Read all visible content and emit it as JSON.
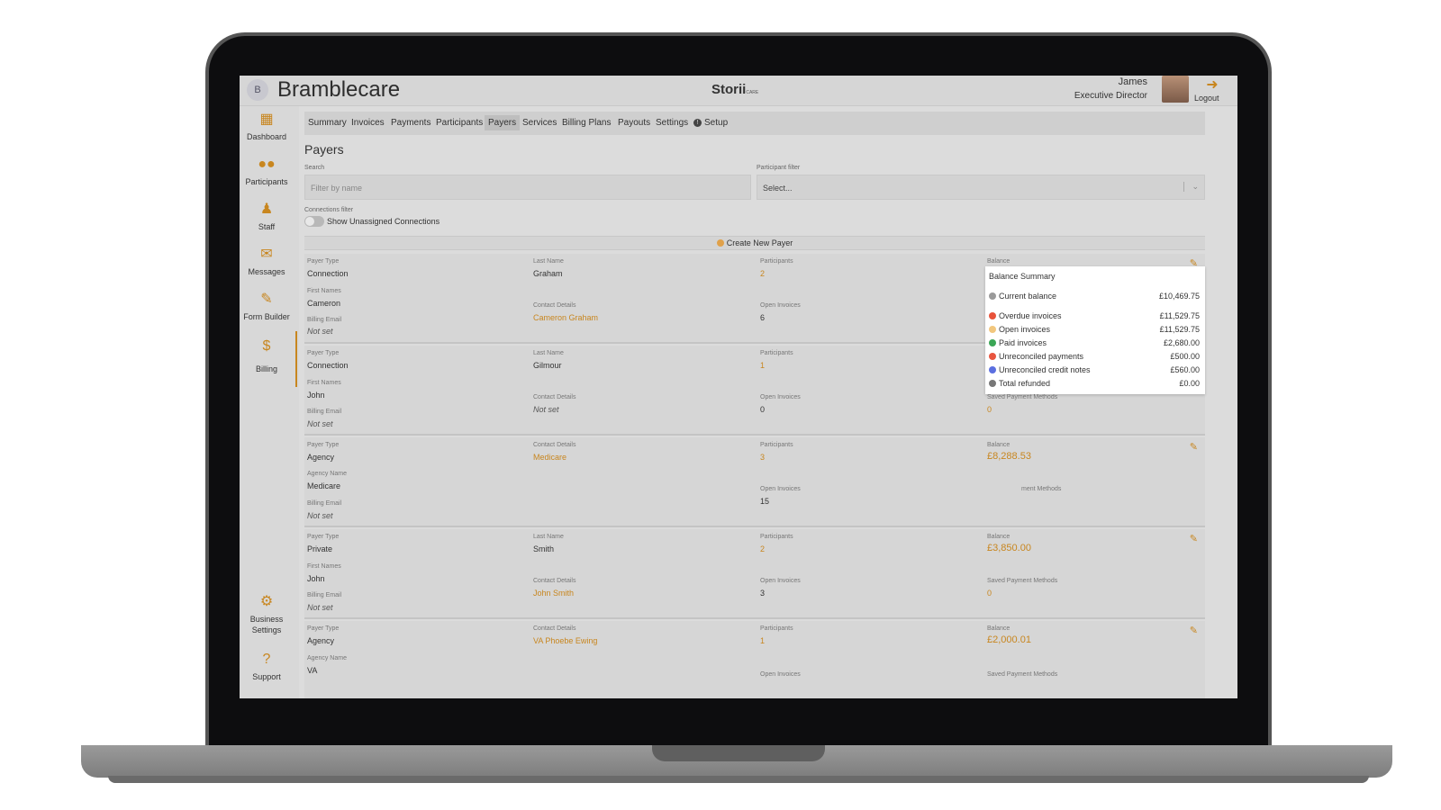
{
  "header": {
    "logo_text": "B",
    "brand": "Bramblecare",
    "product": "Storii",
    "product_sub": "CARE",
    "user_name": "James",
    "user_role": "Executive Director",
    "logout_label": "Logout"
  },
  "sidebar": {
    "items": [
      {
        "label": "Dashboard",
        "icon": "dashboard-icon"
      },
      {
        "label": "Participants",
        "icon": "participants-icon"
      },
      {
        "label": "Staff",
        "icon": "staff-icon"
      },
      {
        "label": "Messages",
        "icon": "messages-icon"
      },
      {
        "label": "Form Builder",
        "icon": "form-builder-icon"
      },
      {
        "label": "Billing",
        "icon": "billing-icon"
      }
    ],
    "bottom": [
      {
        "label": "Business Settings",
        "icon": "gear-icon"
      },
      {
        "label": "Support",
        "icon": "help-icon"
      }
    ]
  },
  "tabs": [
    "Summary",
    "Invoices",
    "Payments",
    "Participants",
    "Payers",
    "Services",
    "Billing Plans",
    "Payouts",
    "Settings",
    "Setup"
  ],
  "active_tab": "Payers",
  "page": {
    "title": "Payers",
    "search_label": "Search",
    "search_placeholder": "Filter by name",
    "participant_filter_label": "Participant filter",
    "participant_filter_value": "Select...",
    "connections_filter_label": "Connections filter",
    "toggle_label": "Show Unassigned Connections",
    "create_label": "Create New Payer"
  },
  "labels": {
    "payer_type": "Payer Type",
    "first_names": "First Names",
    "billing_email": "Billing Email",
    "last_name": "Last Name",
    "contact_details": "Contact Details",
    "participants": "Participants",
    "open_invoices": "Open Invoices",
    "balance": "Balance",
    "saved_payment_methods": "Saved Payment Methods",
    "agency_name": "Agency Name",
    "ment_methods_partial": "ment Methods"
  },
  "payers": [
    {
      "type": "Connection",
      "first_names": "Cameron",
      "billing_email": "Not set",
      "last_name": "Graham",
      "contact": "Cameron Graham",
      "participants": "2",
      "open_invoices": "6"
    },
    {
      "type": "Connection",
      "first_names": "John",
      "billing_email": "Not set",
      "last_name": "Gilmour",
      "contact": "Not set",
      "participants": "1",
      "open_invoices": "0",
      "saved_methods": "0"
    },
    {
      "type": "Agency",
      "agency_name": "Medicare",
      "billing_email": "Not set",
      "contact": "Medicare",
      "participants": "3",
      "open_invoices": "15",
      "balance": "£8,288.53"
    },
    {
      "type": "Private",
      "first_names": "John",
      "billing_email": "Not set",
      "last_name": "Smith",
      "contact": "John Smith",
      "participants": "2",
      "open_invoices": "3",
      "balance": "£3,850.00",
      "saved_methods": "0"
    },
    {
      "type": "Agency",
      "agency_name": "VA",
      "contact": "VA Phoebe Ewing",
      "participants": "1",
      "balance": "£2,000.01"
    }
  ],
  "balance_summary": {
    "title": "Balance Summary",
    "rows": [
      {
        "label": "Current balance",
        "amount": "£10,469.75",
        "color": "#9a9a9a"
      },
      {
        "label": "Overdue invoices",
        "amount": "£11,529.75",
        "color": "#e8523a"
      },
      {
        "label": "Open invoices",
        "amount": "£11,529.75",
        "color": "#f2c77e"
      },
      {
        "label": "Paid invoices",
        "amount": "£2,680.00",
        "color": "#3aa655"
      },
      {
        "label": "Unreconciled payments",
        "amount": "£500.00",
        "color": "#e8553f"
      },
      {
        "label": "Unreconciled credit notes",
        "amount": "£560.00",
        "color": "#5b6fe0"
      },
      {
        "label": "Total refunded",
        "amount": "£0.00",
        "color": "#777777"
      }
    ]
  },
  "colors": {
    "accent": "#c8861f"
  }
}
